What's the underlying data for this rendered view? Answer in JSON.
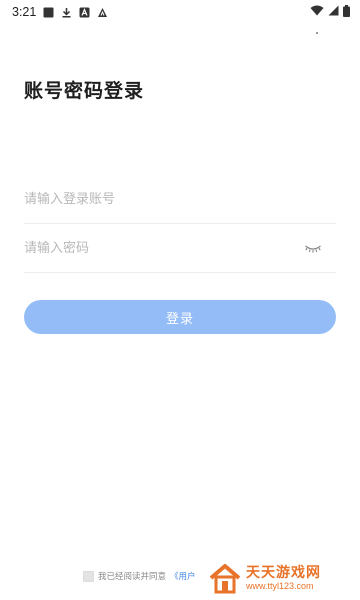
{
  "status_bar": {
    "time": "3:21",
    "icons": [
      "gallery-icon",
      "download-icon",
      "a-box-icon",
      "a-triangle-icon"
    ],
    "right_icons": [
      "wifi-icon",
      "signal-icon",
      "battery-icon"
    ]
  },
  "title": "账号密码登录",
  "account": {
    "placeholder": "请输入登录账号",
    "value": ""
  },
  "password": {
    "placeholder": "请输入密码",
    "value": ""
  },
  "login_button": {
    "label": "登录",
    "color": "#94bdf8"
  },
  "agreement": {
    "text": "我已经阅读并同意",
    "link": "《用户"
  },
  "watermark": {
    "title": "天天游戏网",
    "url": "www.ttyl123.com",
    "color": "#e8732a"
  }
}
